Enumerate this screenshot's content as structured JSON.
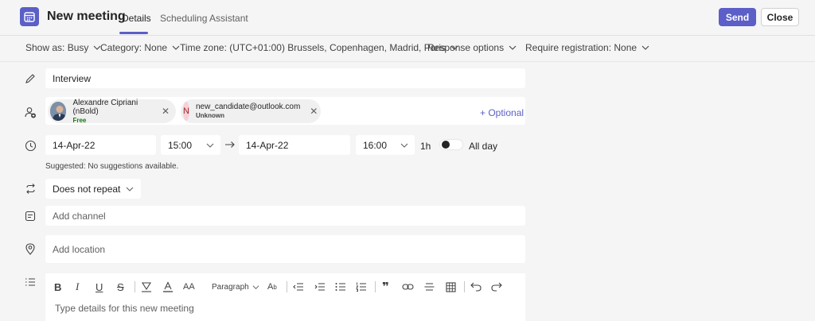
{
  "header": {
    "title": "New meeting",
    "tabs": [
      {
        "label": "Details",
        "active": true
      },
      {
        "label": "Scheduling Assistant",
        "active": false
      }
    ],
    "send_label": "Send",
    "close_label": "Close",
    "accent_color": "#5b5fc7"
  },
  "options": {
    "show_as": "Show as: Busy",
    "category": "Category: None",
    "time_zone": "Time zone: (UTC+01:00) Brussels, Copenhagen, Madrid, Paris",
    "response_options": "Response options",
    "require_registration": "Require registration: None"
  },
  "title_field": {
    "value": "Interview"
  },
  "attendees": {
    "items": [
      {
        "name": "Alexandre Cipriani (nBold)",
        "status": "Free",
        "status_color": "#107c10",
        "avatar": "photo"
      },
      {
        "name": "new_candidate@outlook.com",
        "status": "Unknown",
        "status_color": "#424242",
        "avatar_initial": "N"
      }
    ],
    "optional_label": "+ Optional"
  },
  "datetime": {
    "start_date": "14-Apr-22",
    "start_time": "15:00",
    "end_date": "14-Apr-22",
    "end_time": "16:00",
    "duration": "1h",
    "all_day_label": "All day",
    "all_day_on": false,
    "suggestion_note": "Suggested: No suggestions available."
  },
  "repeat": {
    "value": "Does not repeat"
  },
  "channel": {
    "placeholder": "Add channel"
  },
  "location": {
    "placeholder": "Add location"
  },
  "editor": {
    "paragraph_label": "Paragraph",
    "placeholder": "Type details for this new meeting"
  }
}
